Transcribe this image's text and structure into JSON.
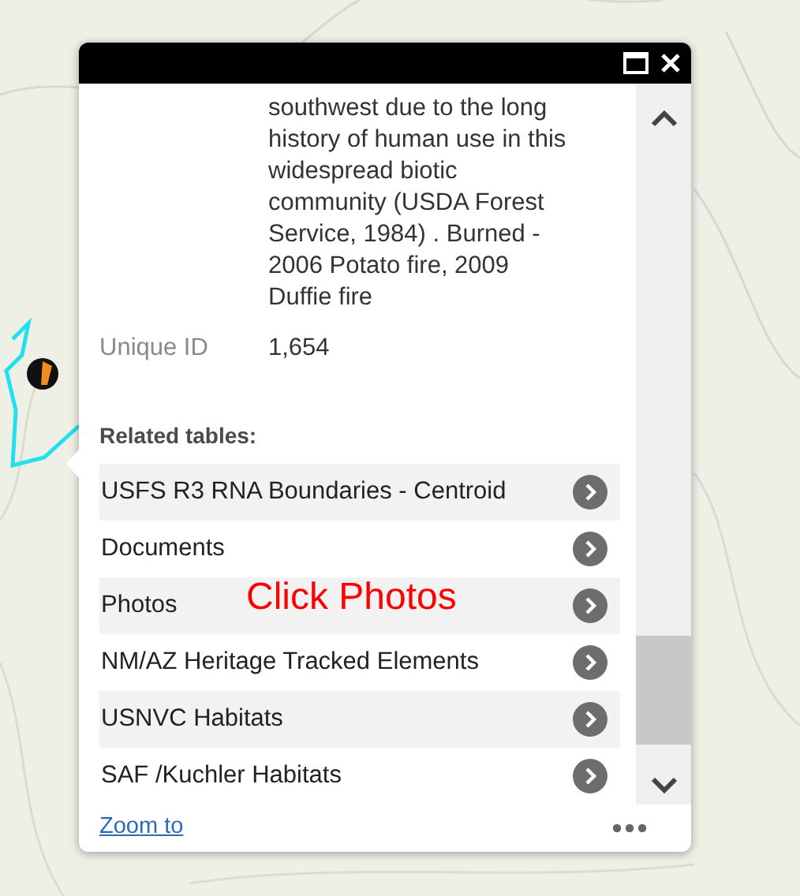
{
  "popup": {
    "description": "southwest due to the long history of human use in this widespread biotic community (USDA Forest Service, 1984) . Burned - 2006 Potato fire, 2009 Duffie fire",
    "fields": [
      {
        "label": "Unique ID",
        "value": "1,654"
      }
    ],
    "related_heading": "Related tables:",
    "related_tables": [
      {
        "label": "USFS R3 RNA Boundaries - Centroid"
      },
      {
        "label": "Documents"
      },
      {
        "label": "Photos"
      },
      {
        "label": "NM/AZ Heritage Tracked Elements"
      },
      {
        "label": "USNVC Habitats"
      },
      {
        "label": "SAF /Kuchler Habitats"
      }
    ],
    "footer_link": "Zoom to"
  },
  "annotation": "Click Photos"
}
